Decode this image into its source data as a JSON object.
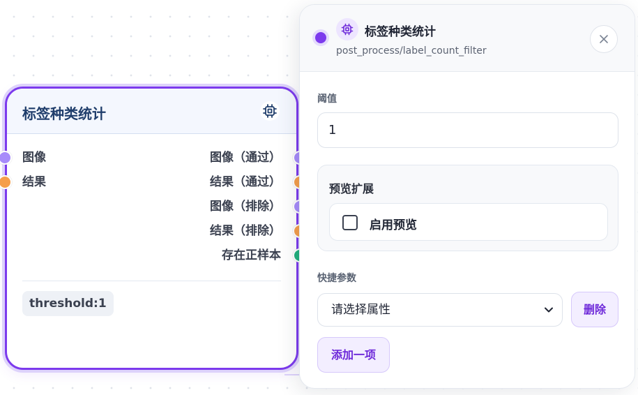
{
  "node": {
    "title": "标签种类统计",
    "icon": "chip-icon",
    "inputs": [
      {
        "label": "图像",
        "color": "#a78bfa"
      },
      {
        "label": "结果",
        "color": "#f59e4b"
      }
    ],
    "outputs": [
      {
        "label": "图像（通过）",
        "color": "#a78bfa"
      },
      {
        "label": "结果（通过）",
        "color": "#f59e4b"
      },
      {
        "label": "图像（排除）",
        "color": "#a78bfa"
      },
      {
        "label": "结果（排除）",
        "color": "#f59e4b"
      },
      {
        "label": "存在正样本",
        "color": "#22b07d"
      }
    ],
    "param_badge": "threshold:1"
  },
  "panel": {
    "title": "标签种类统计",
    "path": "post_process/label_count_filter",
    "icon": "chip-icon",
    "close_icon": "close-icon",
    "accent": "#7c3aed",
    "threshold_label": "阈值",
    "threshold_value": "1",
    "preview_section_title": "预览扩展",
    "preview_checkbox_label": "启用预览",
    "preview_checked": false,
    "quick_params_label": "快捷参数",
    "select_placeholder": "请选择属性",
    "delete_label": "删除",
    "add_label": "添加一项"
  }
}
